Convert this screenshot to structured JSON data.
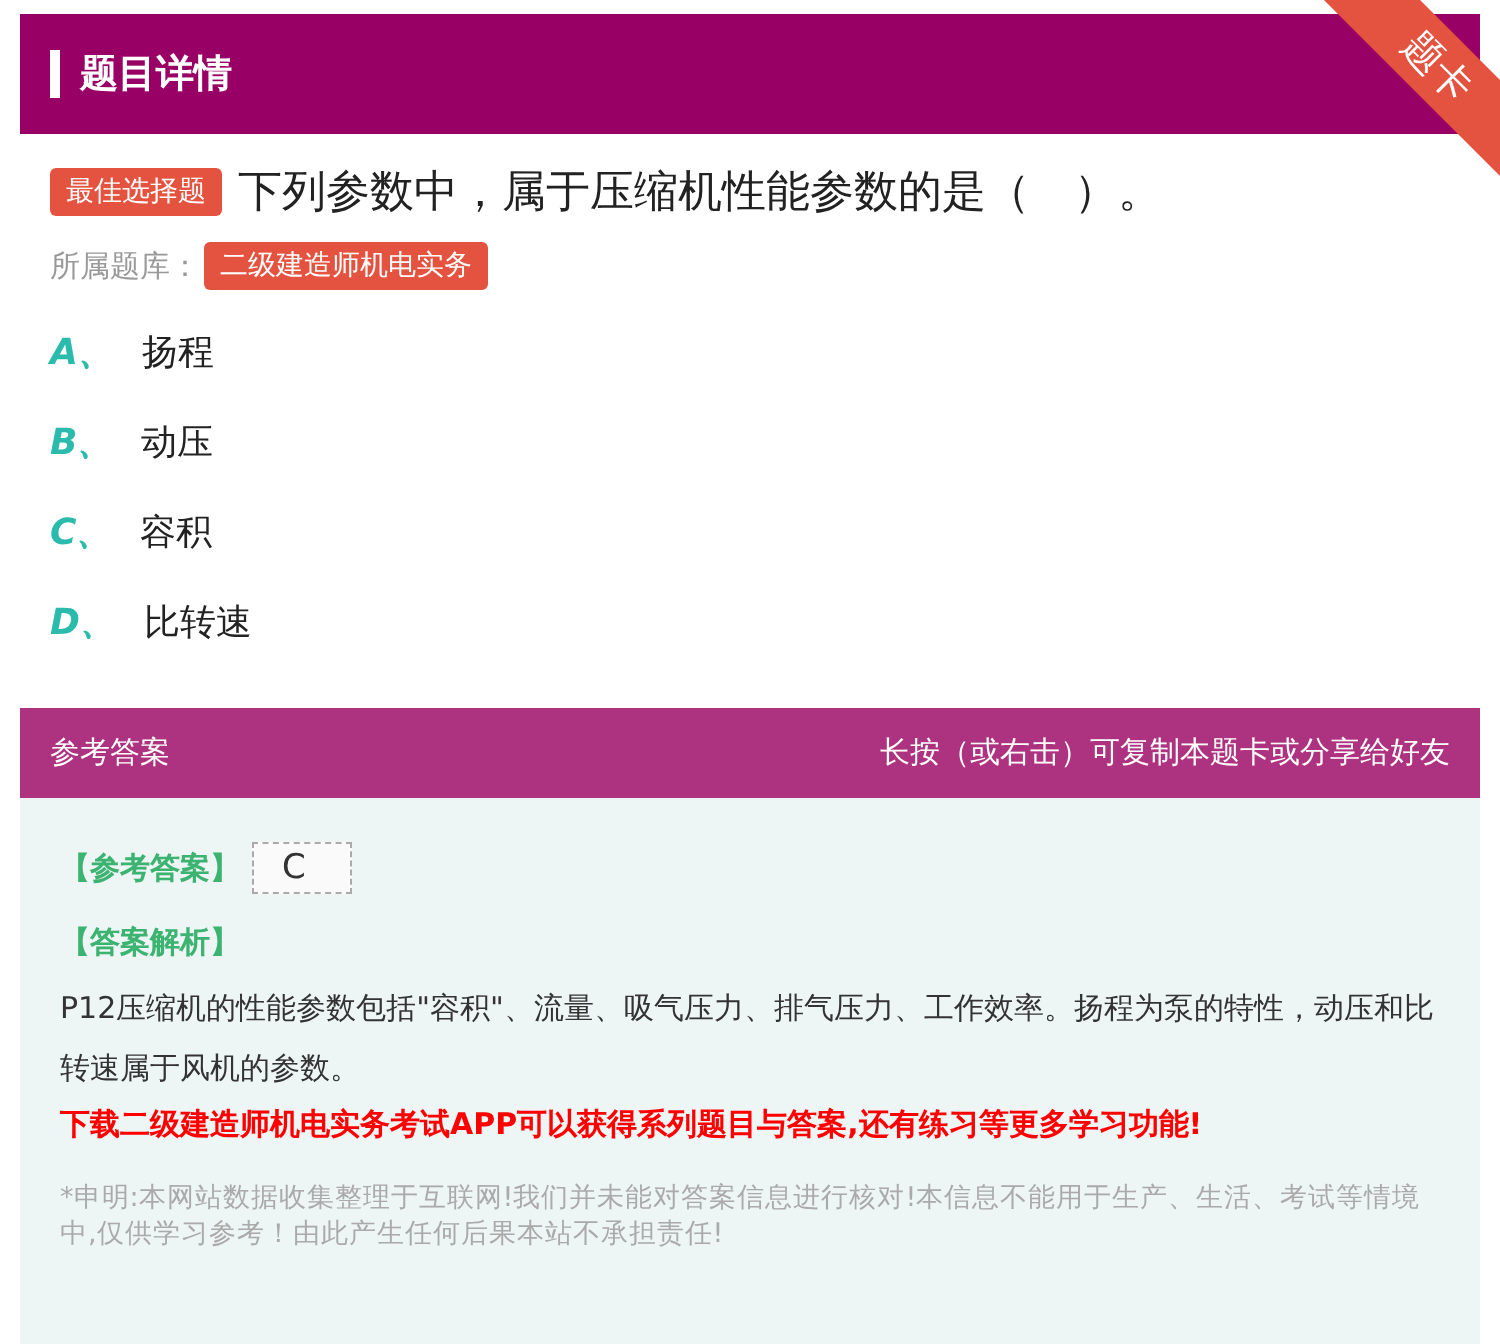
{
  "header": {
    "title": "题目详情",
    "ribbon": "题卡"
  },
  "question": {
    "type_badge": "最佳选择题",
    "text": "下列参数中，属于压缩机性能参数的是（　）。",
    "bank_label": "所属题库：",
    "bank": "二级建造师机电实务"
  },
  "options": [
    {
      "letter": "A、",
      "text": "扬程"
    },
    {
      "letter": "B、",
      "text": "动压"
    },
    {
      "letter": "C、",
      "text": "容积"
    },
    {
      "letter": "D、",
      "text": "比转速"
    }
  ],
  "answer_panel": {
    "title": "参考答案",
    "hint": "长按（或右击）可复制本题卡或分享给好友",
    "answer_label": "【参考答案】",
    "answer": "C",
    "analysis_label": "【答案解析】",
    "analysis": "P12压缩机的性能参数包括\"容积\"、流量、吸气压力、排气压力、工作效率。扬程为泵的特性，动压和比转速属于风机的参数。",
    "promo": "下载二级建造师机电实务考试APP可以获得系列题目与答案,还有练习等更多学习功能!",
    "disclaimer": "*申明:本网站数据收集整理于互联网!我们并未能对答案信息进行核对!本信息不能用于生产、生活、考试等情境中,仅供学习参考！由此产生任何后果本站不承担责任!"
  }
}
